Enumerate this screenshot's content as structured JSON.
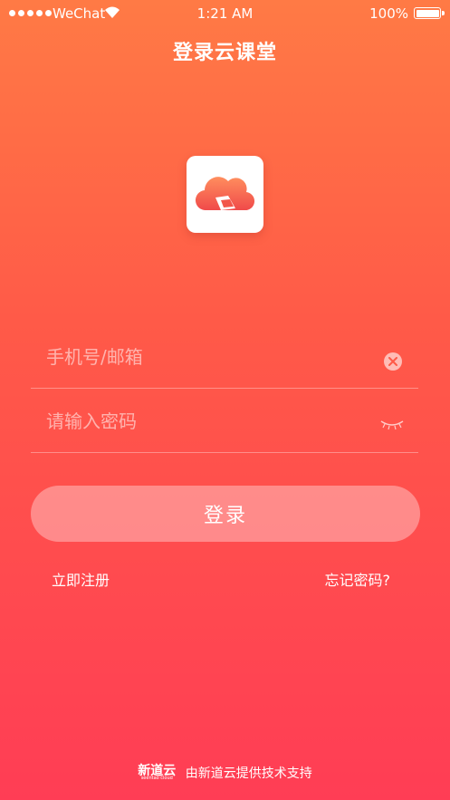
{
  "status_bar": {
    "carrier": "WeChat",
    "time": "1:21 AM",
    "battery": "100%"
  },
  "header": {
    "title": "登录云课堂"
  },
  "form": {
    "phone_placeholder": "手机号/邮箱",
    "password_placeholder": "请输入密码",
    "login_label": "登录",
    "register_label": "立即注册",
    "forgot_label": "忘记密码?"
  },
  "footer": {
    "logo_text": "新道云",
    "logo_subtext": "seentao cloud",
    "text": "由新道云提供技术支持"
  },
  "colors": {
    "gradient_top": "#FF7A45",
    "gradient_bottom": "#FF3D55",
    "logo_accent": "#F2564A"
  },
  "icons": [
    "signal-icon",
    "wifi-icon",
    "battery-icon",
    "cloud-logo-icon",
    "clear-icon",
    "eye-closed-icon"
  ]
}
